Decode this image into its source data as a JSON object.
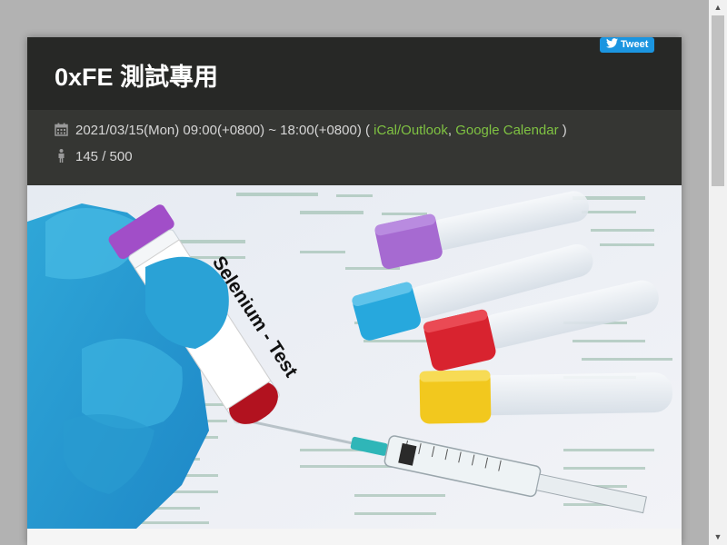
{
  "event": {
    "title": "0xFE 測試專用",
    "datetime": "2021/03/15(Mon) 09:00(+0800) ~ 18:00(+0800) (",
    "cal_ical": "iCal/Outlook",
    "cal_sep": ",",
    "cal_google": "Google Calendar",
    "cal_close": ")",
    "attendance": "145 / 500"
  },
  "share": {
    "tweet_label": "Tweet"
  },
  "hero": {
    "tube_label": "Selenium - Test"
  },
  "colors": {
    "link": "#7fc242",
    "tweet": "#1b95e0",
    "header": "#272826",
    "meta": "#353633"
  },
  "icons": {
    "calendar": "calendar-icon",
    "person": "person-icon",
    "twitter": "twitter-bird-icon"
  }
}
